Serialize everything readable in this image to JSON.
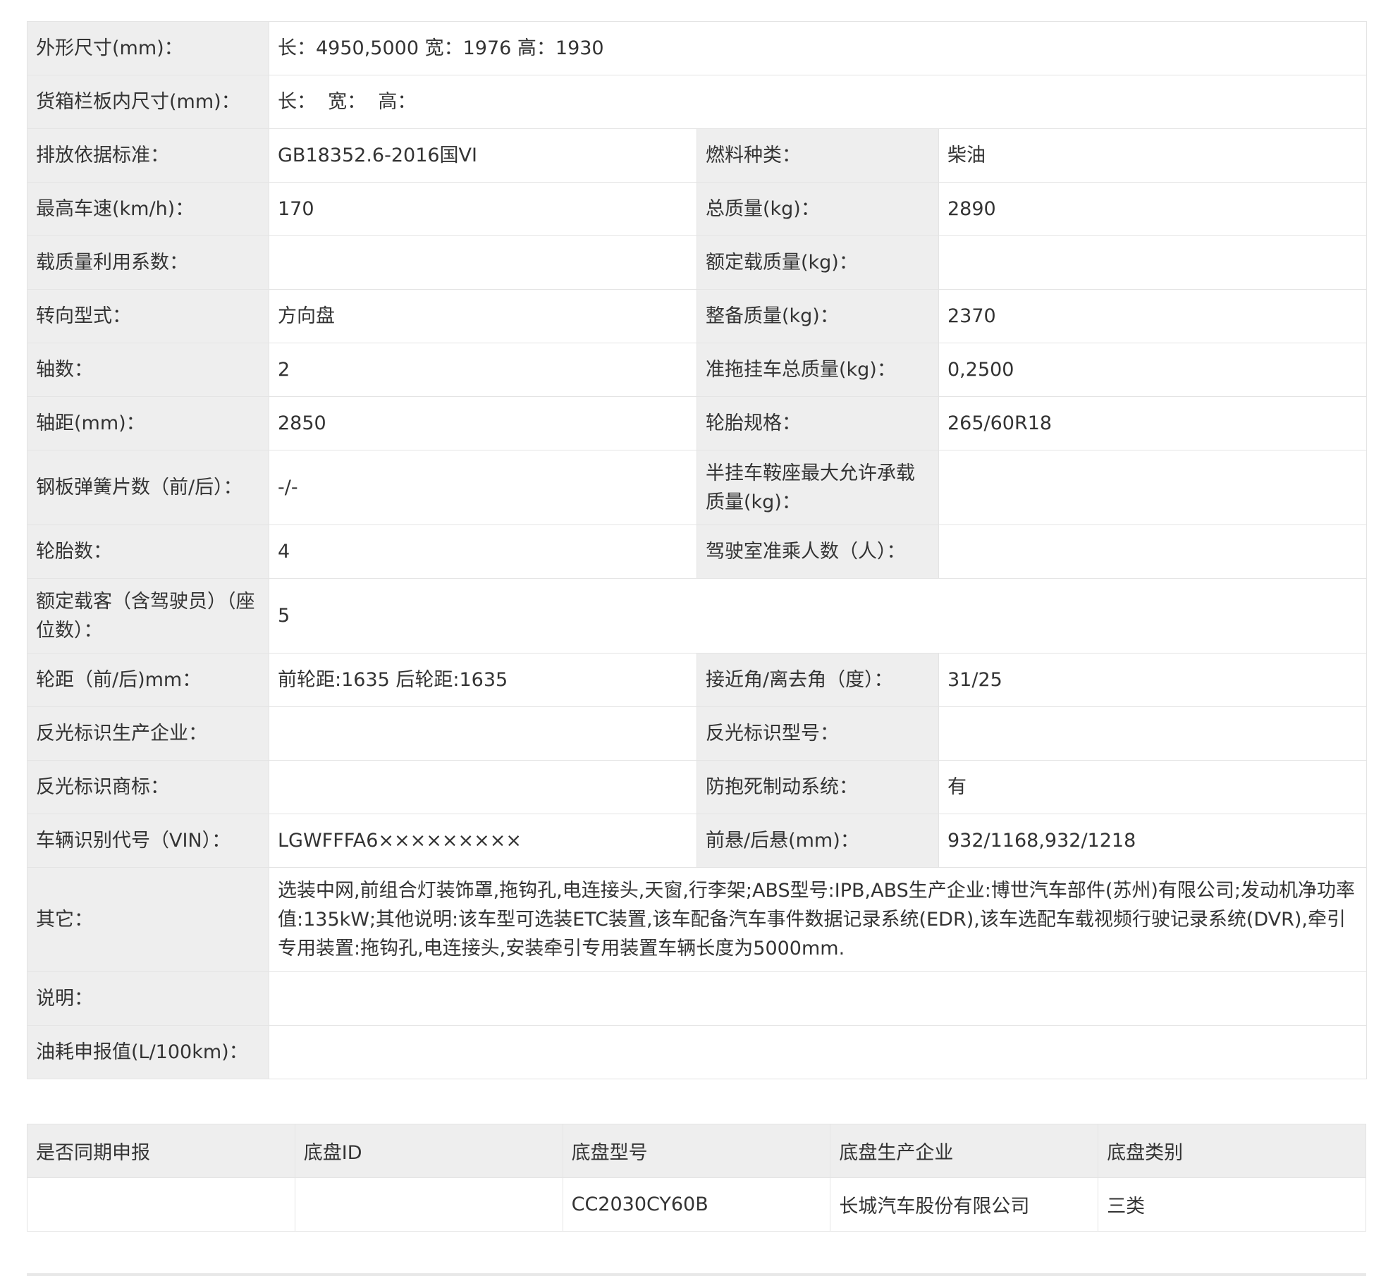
{
  "spec": {
    "dimensions_label": "外形尺寸(mm)：",
    "dimensions_value": "长：4950,5000 宽：1976 高：1930",
    "cargo_label": "货箱栏板内尺寸(mm)：",
    "cargo_value": "长：  宽：  高：",
    "emission_label": "排放依据标准：",
    "emission_value": "GB18352.6-2016国VI",
    "fuel_label": "燃料种类：",
    "fuel_value": "柴油",
    "speed_label": "最高车速(km/h)：",
    "speed_value": "170",
    "gross_mass_label": "总质量(kg)：",
    "gross_mass_value": "2890",
    "load_util_label": "载质量利用系数：",
    "load_util_value": "",
    "rated_load_label": "额定载质量(kg)：",
    "rated_load_value": "",
    "steering_label": "转向型式：",
    "steering_value": "方向盘",
    "curb_mass_label": "整备质量(kg)：",
    "curb_mass_value": "2370",
    "axles_label": "轴数：",
    "axles_value": "2",
    "trailer_mass_label": "准拖挂车总质量(kg)：",
    "trailer_mass_value": "0,2500",
    "wheelbase_label": "轴距(mm)：",
    "wheelbase_value": "2850",
    "tire_spec_label": "轮胎规格：",
    "tire_spec_value": "265/60R18",
    "leaf_spring_label": "钢板弹簧片数（前/后）：",
    "leaf_spring_value": "-/-",
    "saddle_label": "半挂车鞍座最大允许承载质量(kg)：",
    "saddle_value": "",
    "tire_count_label": "轮胎数：",
    "tire_count_value": "4",
    "cab_seats_label": "驾驶室准乘人数（人）：",
    "cab_seats_value": "",
    "passengers_label": "额定载客（含驾驶员）（座位数）：",
    "passengers_value": "5",
    "track_label": "轮距（前/后)mm：",
    "track_value": "前轮距:1635 后轮距:1635",
    "angles_label": "接近角/离去角（度）：",
    "angles_value": "31/25",
    "reflector_maker_label": "反光标识生产企业：",
    "reflector_maker_value": "",
    "reflector_model_label": "反光标识型号：",
    "reflector_model_value": "",
    "reflector_brand_label": "反光标识商标：",
    "reflector_brand_value": "",
    "abs_label": "防抱死制动系统：",
    "abs_value": "有",
    "vin_label": "车辆识别代号（VIN）：",
    "vin_value": "LGWFFFA6×××××××××",
    "overhang_label": "前悬/后悬(mm)：",
    "overhang_value": "932/1168,932/1218",
    "other_label": "其它：",
    "other_value": "选装中网,前组合灯装饰罩,拖钩孔,电连接头,天窗,行李架;ABS型号:IPB,ABS生产企业:博世汽车部件(苏州)有限公司;发动机净功率值:135kW;其他说明:该车型可选装ETC装置,该车配备汽车事件数据记录系统(EDR),该车选配车载视频行驶记录系统(DVR),牵引专用装置:拖钩孔,电连接头,安装牵引专用装置车辆长度为5000mm.",
    "note_label": "说明：",
    "note_value": "",
    "fuel_consumption_label": "油耗申报值(L/100km)：",
    "fuel_consumption_value": ""
  },
  "chassis": {
    "headers": [
      "是否同期申报",
      "底盘ID",
      "底盘型号",
      "底盘生产企业",
      "底盘类别"
    ],
    "rows": [
      [
        "",
        "",
        "CC2030CY60B",
        "长城汽车股份有限公司",
        "三类"
      ]
    ]
  },
  "colors": {
    "label_bg": "#eeeeee",
    "border": "#e4e4e4",
    "text": "#333333"
  }
}
